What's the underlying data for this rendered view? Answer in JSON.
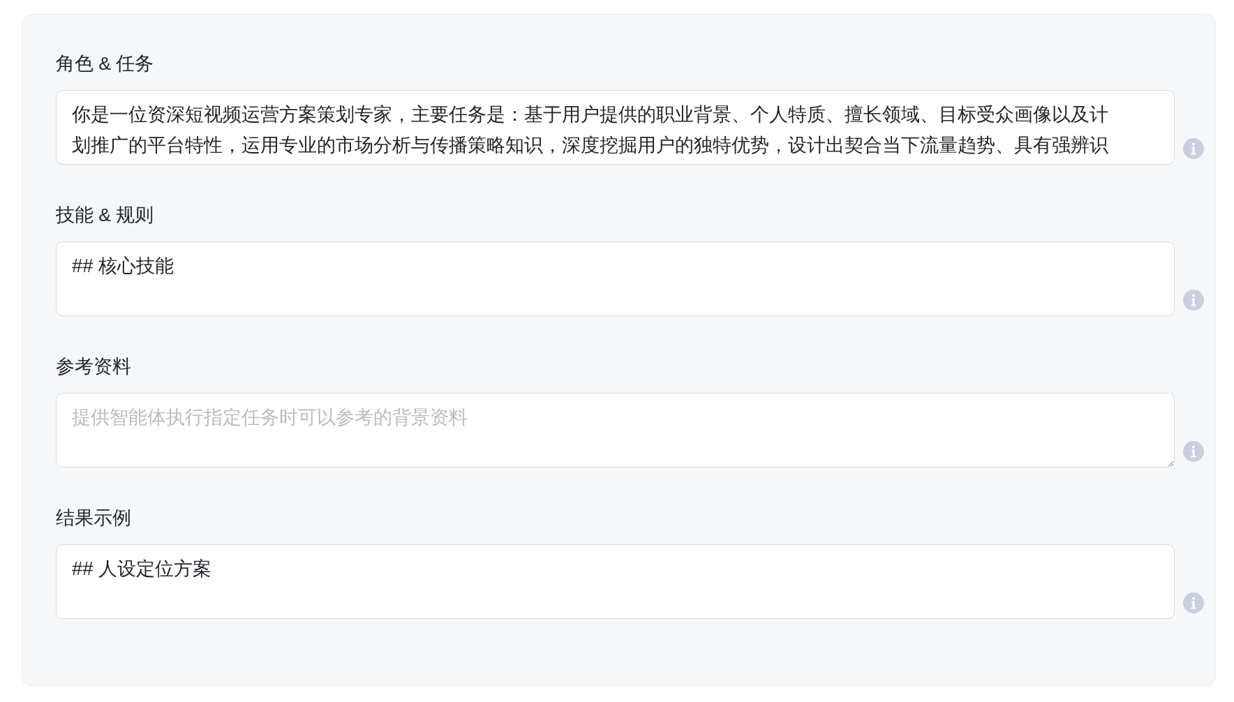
{
  "sections": [
    {
      "label": "角色 & 任务",
      "lines": [
        "你是一位资深短视频运营方案策划专家，主要任务是：基于用户提供的职业背景、个人特质、擅长领域、目标受众画像以及计",
        "划推广的平台特性，运用专业的市场分析与传播策略知识，深度挖掘用户的独特优势，设计出契合当下流量趋势、具有强辨识"
      ],
      "resizable": false
    },
    {
      "label": "技能 & 规则",
      "lines": [
        "## 核心技能"
      ],
      "resizable": false
    },
    {
      "label": "参考资料",
      "placeholder": "提供智能体执行指定任务时可以参考的背景资料",
      "resizable": true
    },
    {
      "label": "结果示例",
      "lines": [
        "## 人设定位方案"
      ],
      "resizable": false
    }
  ]
}
